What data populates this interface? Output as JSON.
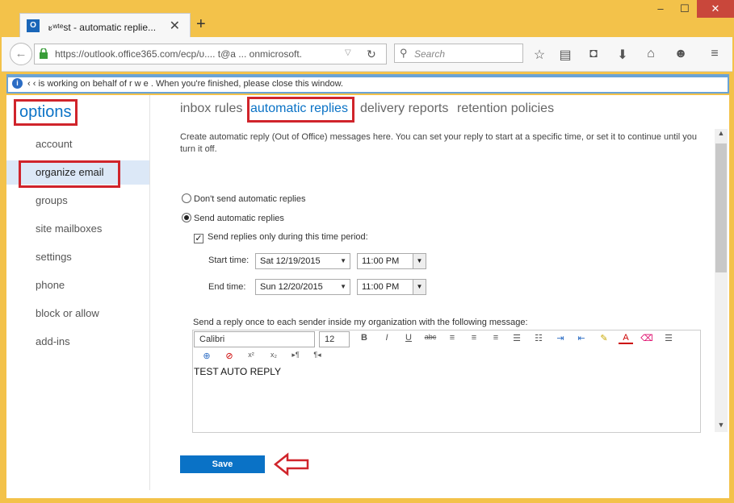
{
  "browser": {
    "tab_title": "ะʷᵗᵉst - automatic replie...",
    "tab_logo": "O",
    "new_tab_symbol": "+",
    "close_symbol": "✕",
    "window_buttons": [
      "–",
      "☐",
      "✕"
    ],
    "url": "https://outlook.office365.com/ecp/ᴜ.... t@a ... onmicrosoft.",
    "search_placeholder": "Search",
    "notice_icon": "i",
    "notice_text": "‹ ‹ is working on behalf of r w e . When you're finished, please close this window."
  },
  "sidebar": {
    "title": "options",
    "items": [
      {
        "label": "account"
      },
      {
        "label": "organize email"
      },
      {
        "label": "groups"
      },
      {
        "label": "site mailboxes"
      },
      {
        "label": "settings"
      },
      {
        "label": "phone"
      },
      {
        "label": "block or allow"
      },
      {
        "label": "add-ins"
      }
    ]
  },
  "main": {
    "tabs": [
      {
        "label": "inbox rules"
      },
      {
        "label": "automatic replies"
      },
      {
        "label": "delivery reports"
      },
      {
        "label": "retention policies"
      }
    ],
    "description": "Create automatic reply (Out of Office) messages here. You can set your reply to start at a specific time, or set it to continue until you turn it off.",
    "radio_off_label": "Don't send automatic replies",
    "radio_on_label": "Send automatic replies",
    "checkbox_label": "Send replies only during this time period:",
    "checkbox_mark": "✓",
    "start_label": "Start time:",
    "start_date": "Sat 12/19/2015",
    "start_time": "11:00 PM",
    "end_label": "End time:",
    "end_date": "Sun 12/20/2015",
    "end_time": "11:00 PM",
    "message_label": "Send a reply once to each sender inside my organization with the following message:",
    "editor": {
      "font": "Calibri",
      "size": "12",
      "body": "TEST AUTO REPLY"
    },
    "save_label": "Save"
  },
  "colors": {
    "accent": "#0a72c6",
    "highlight": "#d0242b"
  }
}
